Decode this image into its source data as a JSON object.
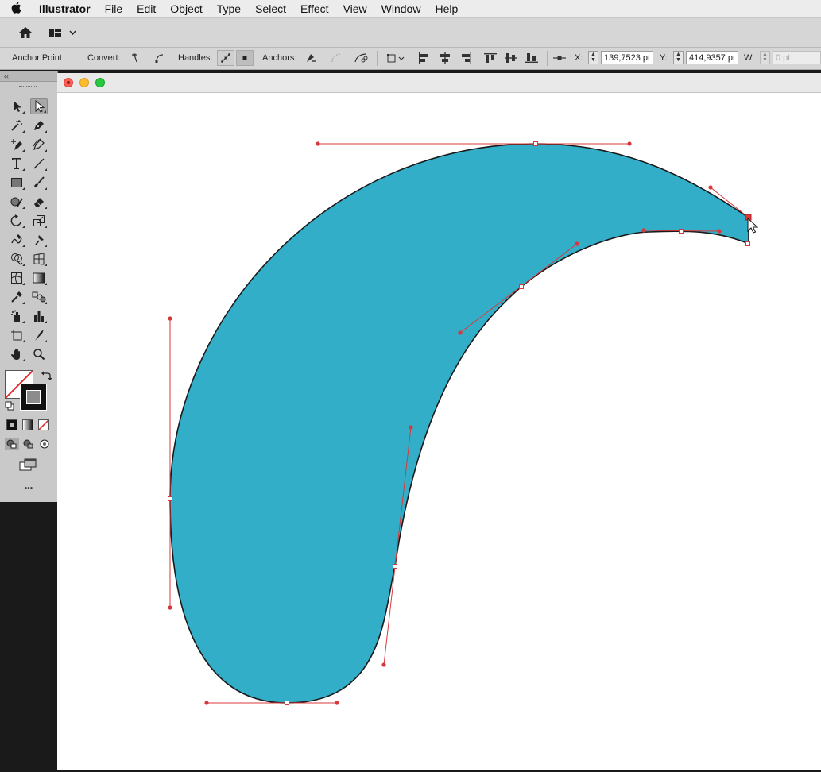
{
  "menu": {
    "apple_icon": "apple-icon",
    "app_name": "Illustrator",
    "items": [
      "File",
      "Edit",
      "Object",
      "Type",
      "Select",
      "Effect",
      "View",
      "Window",
      "Help"
    ]
  },
  "appbar": {
    "home_icon": "home-icon",
    "workspace_icon": "workspace-switcher-icon"
  },
  "control": {
    "selection_type": "Anchor Point",
    "convert_label": "Convert:",
    "handles_label": "Handles:",
    "anchors_label": "Anchors:",
    "x_label": "X:",
    "x_value": "139,7523 pt",
    "y_label": "Y:",
    "y_value": "414,9357 pt",
    "w_label": "W:",
    "w_value": "0 pt"
  },
  "colors": {
    "shape_fill": "#33aec8",
    "path_stroke": "#1a1a1a",
    "handle_color": "#d9383a",
    "canvas": "#ffffff",
    "ui_panel": "#d6d6d6"
  },
  "tools": {
    "panel_header": "‹‹",
    "more_label": "•••",
    "rows": [
      [
        "selection-tool",
        "direct-selection-tool"
      ],
      [
        "magic-wand-tool",
        "pen-tool"
      ],
      [
        "add-anchor-point-tool",
        "curvature-tool"
      ],
      [
        "type-tool",
        "line-segment-tool"
      ],
      [
        "rectangle-tool",
        "paintbrush-tool"
      ],
      [
        "shaper-tool",
        "eraser-tool"
      ],
      [
        "rotate-tool",
        "scale-tool"
      ],
      [
        "warp-tool",
        "puppet-warp-tool"
      ],
      [
        "shape-builder-tool",
        "perspective-grid-tool"
      ],
      [
        "mesh-tool",
        "gradient-tool"
      ],
      [
        "eyedropper-tool",
        "blend-tool"
      ],
      [
        "symbol-sprayer-tool",
        "column-graph-tool"
      ],
      [
        "artboard-tool",
        "slice-tool"
      ],
      [
        "hand-tool",
        "zoom-tool"
      ]
    ]
  }
}
